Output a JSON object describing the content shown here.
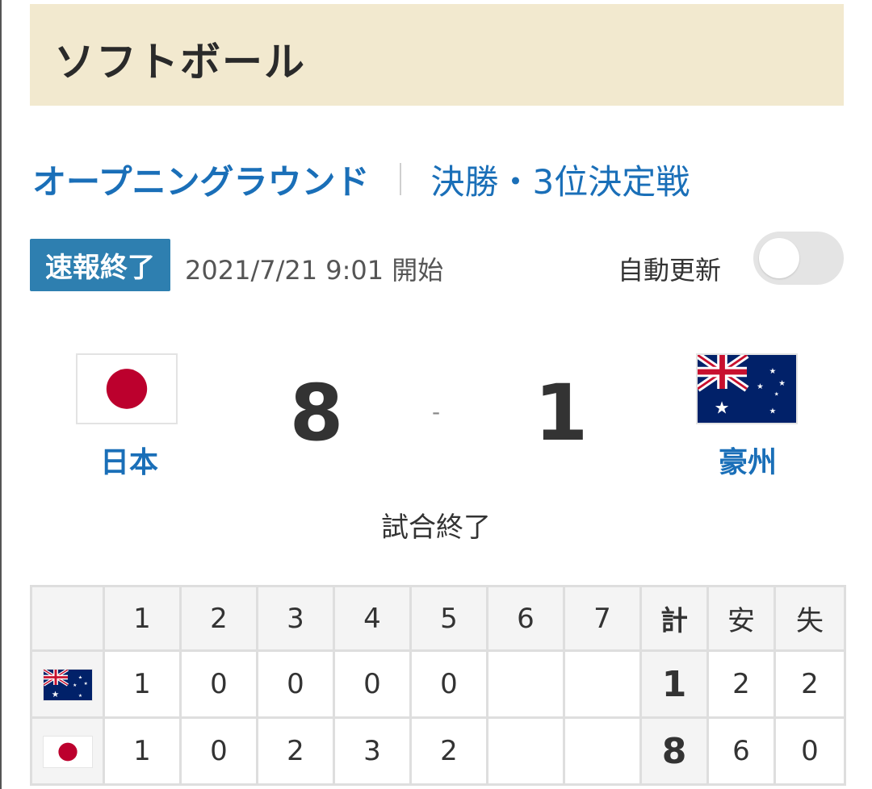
{
  "header": {
    "title": "ソフトボール"
  },
  "round_nav": {
    "items": [
      {
        "label": "オープニングラウンド",
        "active": true
      },
      {
        "label": "決勝・3位決定戦",
        "active": false
      }
    ]
  },
  "status": {
    "badge": "速報終了",
    "start_time": "2021/7/21 9:01 開始",
    "auto_refresh_label": "自動更新",
    "auto_refresh_on": false
  },
  "match": {
    "home": {
      "name": "日本",
      "flag": "japan-flag-icon",
      "score": "8"
    },
    "away": {
      "name": "豪州",
      "flag": "australia-flag-icon",
      "score": "1"
    },
    "separator": "-",
    "status": "試合終了"
  },
  "linescore": {
    "headers": [
      "",
      "1",
      "2",
      "3",
      "4",
      "5",
      "6",
      "7",
      "計",
      "安",
      "失"
    ],
    "rows": [
      {
        "flag": "australia-flag-icon",
        "innings": [
          "1",
          "0",
          "0",
          "0",
          "0",
          "",
          ""
        ],
        "total": "1",
        "hits": "2",
        "errors": "2"
      },
      {
        "flag": "japan-flag-icon",
        "innings": [
          "1",
          "0",
          "2",
          "3",
          "2",
          "",
          ""
        ],
        "total": "8",
        "hits": "6",
        "errors": "0"
      }
    ]
  },
  "colors": {
    "accent_blue": "#1a6fb8",
    "badge_blue": "#2e7fb0",
    "header_bg": "#f2e9cf",
    "japan_red": "#bc002d",
    "australia_blue": "#012169"
  }
}
